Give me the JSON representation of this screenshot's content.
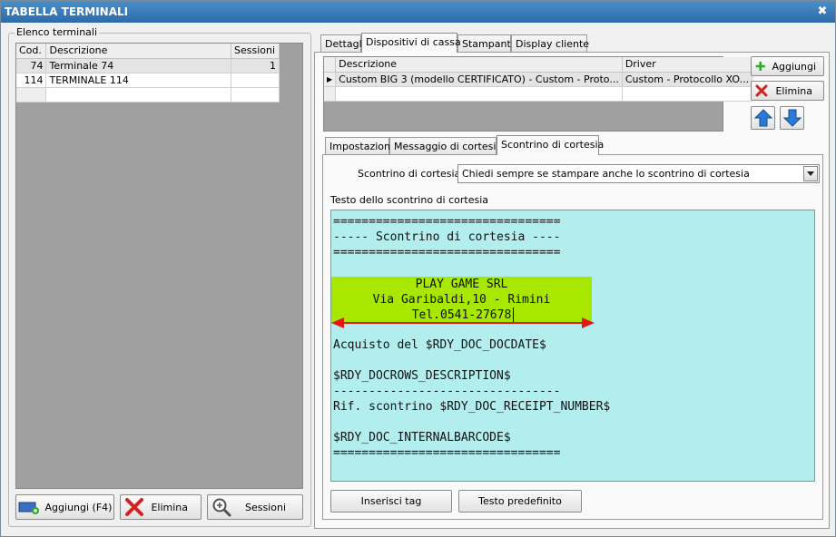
{
  "window": {
    "title": "TABELLA TERMINALI",
    "close_glyph": "✖"
  },
  "left_panel": {
    "caption": "Elenco terminali",
    "columns": [
      "Cod.",
      "Descrizione",
      "Sessioni"
    ],
    "rows": [
      {
        "cod": "74",
        "descrizione": "Terminale 74",
        "sessioni": "1"
      },
      {
        "cod": "114",
        "descrizione": "TERMINALE 114",
        "sessioni": ""
      }
    ],
    "buttons": {
      "add": "Aggiungi (F4)",
      "delete": "Elimina",
      "sessions": "Sessioni"
    }
  },
  "tabs": {
    "main": [
      "Dettagli",
      "Dispositivi di cassa",
      "Stampanti",
      "Display cliente"
    ],
    "main_active": "Dispositivi di cassa",
    "sub": [
      "Impostazioni",
      "Messaggio di cortesia",
      "Scontrino di cortesia"
    ],
    "sub_active": "Scontrino di cortesia"
  },
  "devices": {
    "columns": [
      "Descrizione",
      "Driver"
    ],
    "rows": [
      {
        "descrizione": "Custom BIG 3 (modello CERTIFICATO) - Custom - Proto...",
        "driver": "Custom - Protocollo XO..."
      }
    ],
    "row_indicator": "▶",
    "add_label": "Aggiungi",
    "delete_label": "Elimina"
  },
  "courtesy": {
    "field_label": "Scontrino di cortesia :",
    "selected_option": "Chiedi sempre se stampare anche lo scontrino di cortesia",
    "text_label": "Testo dello scontrino di cortesia",
    "lines": [
      "================================",
      "----- Scontrino di cortesia ----",
      "================================",
      "",
      "",
      "",
      "",
      "",
      "Acquisto del $RDY_DOC_DOCDATE$",
      "",
      "$RDY_DOCROWS_DESCRIPTION$",
      "--------------------------------",
      "Rif. scontrino $RDY_DOC_RECEIPT_NUMBER$",
      "",
      "$RDY_DOC_INTERNALBARCODE$",
      "================================"
    ],
    "header_lines": [
      "PLAY GAME SRL",
      "Via Garibaldi,10 - Rimini",
      "Tel.0541-27678"
    ],
    "insert_tag_button": "Inserisci tag",
    "default_text_button": "Testo predefinito"
  },
  "colors": {
    "receipt_bg": "#b2eeee",
    "highlight": "#a8e800",
    "arrow": "#e01818",
    "title_bar": "#2c6aa8"
  }
}
